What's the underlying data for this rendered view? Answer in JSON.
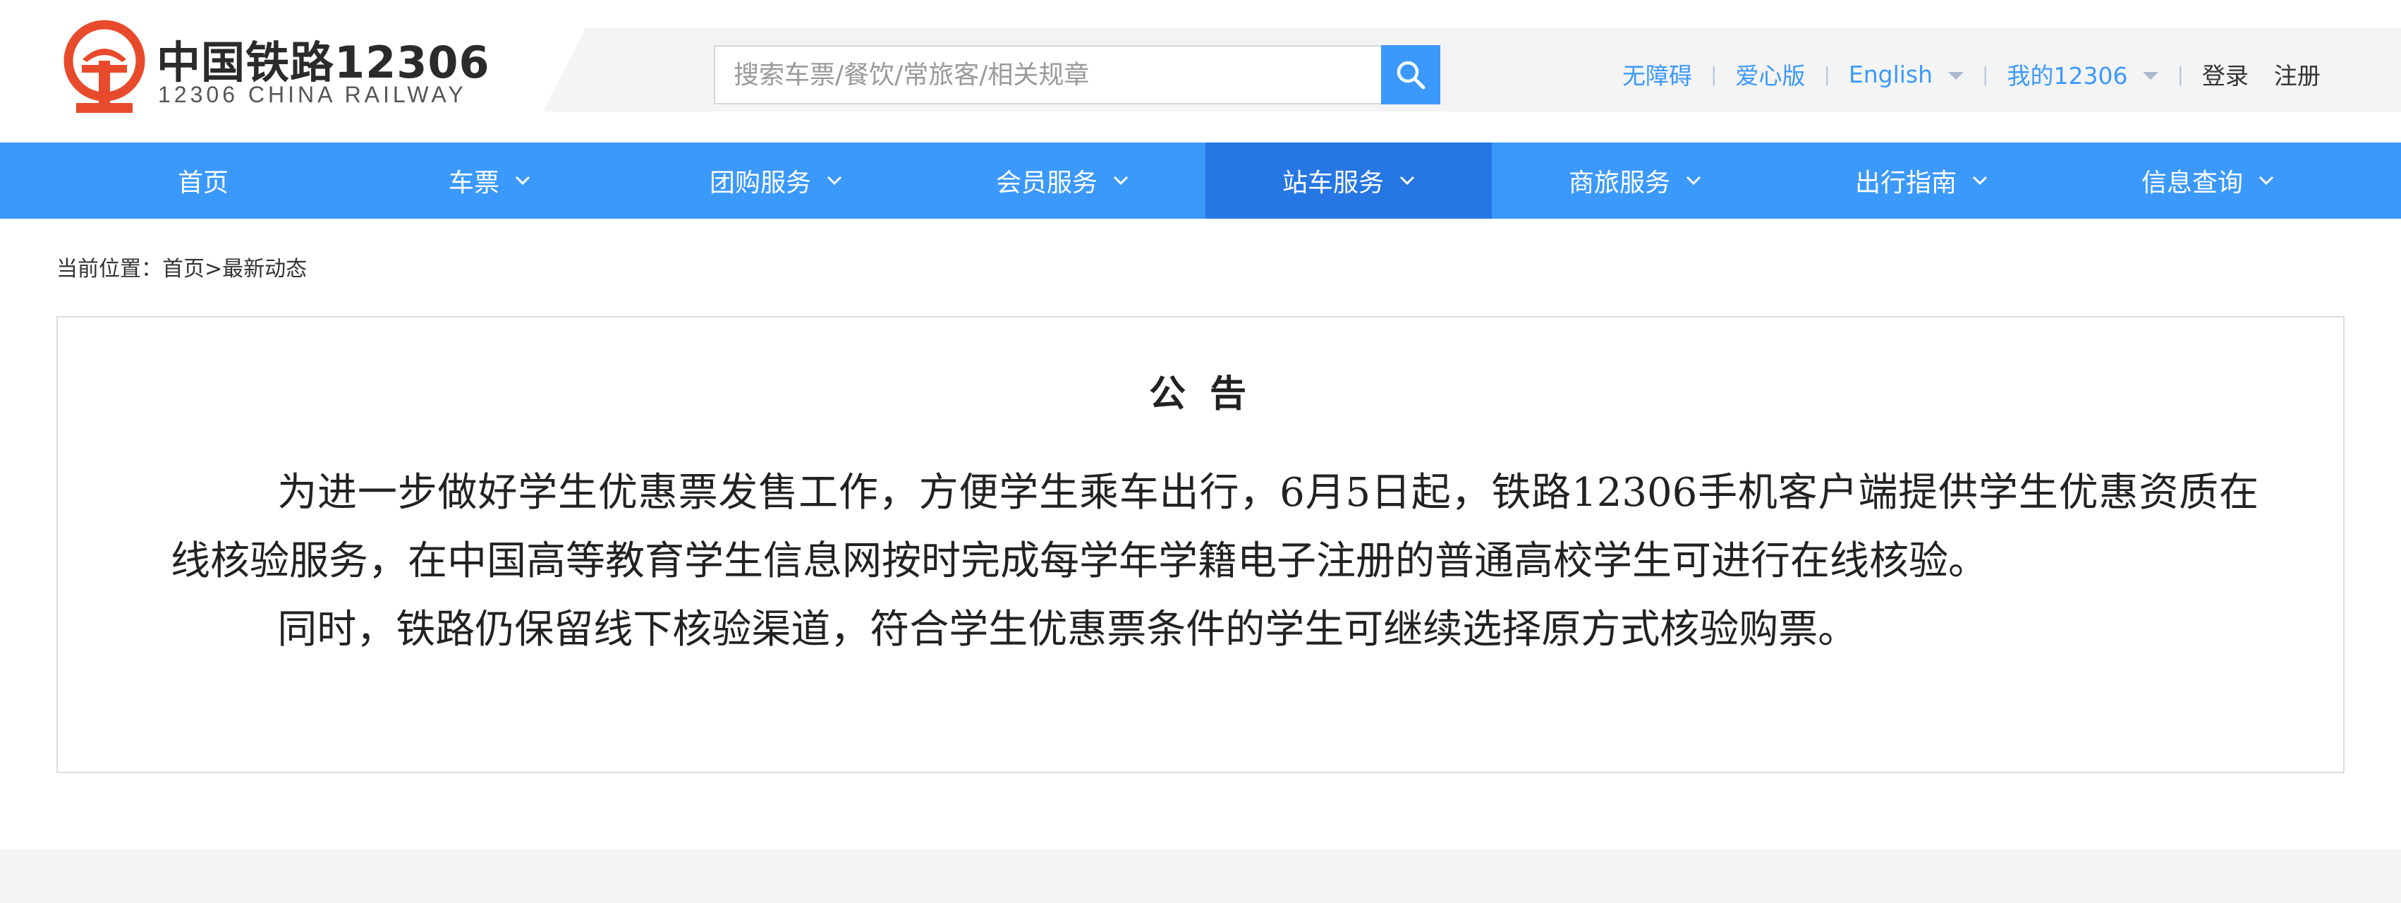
{
  "brand": {
    "name_cn": "中国铁路12306",
    "name_en": "12306 CHINA RAILWAY",
    "logo_icon": "china-railway-logo-icon",
    "color": "#e84b2c"
  },
  "search": {
    "placeholder": "搜索车票/餐饮/常旅客/相关规章",
    "button_icon": "search-icon"
  },
  "top_links": {
    "accessibility": "无障碍",
    "care_mode": "爱心版",
    "language": "English",
    "my_account": "我的12306",
    "login": "登录",
    "register": "注册"
  },
  "nav": {
    "items": [
      {
        "label": "首页"
      },
      {
        "label": "车票"
      },
      {
        "label": "团购服务"
      },
      {
        "label": "会员服务"
      },
      {
        "label": "站车服务"
      },
      {
        "label": "商旅服务"
      },
      {
        "label": "出行指南"
      },
      {
        "label": "信息查询"
      }
    ],
    "active": "站车服务"
  },
  "breadcrumb": {
    "prefix": "当前位置：",
    "home": "首页",
    "separator": ">",
    "current": "最新动态"
  },
  "notice": {
    "title": "公 告",
    "paragraphs": [
      "为进一步做好学生优惠票发售工作，方便学生乘车出行，6月5日起，铁路12306手机客户端提供学生优惠资质在线核验服务，在中国高等教育学生信息网按时完成每学年学籍电子注册的普通高校学生可进行在线核验。",
      "同时，铁路仍保留线下核验渠道，符合学生优惠票条件的学生可继续选择原方式核验购票。"
    ]
  },
  "colors": {
    "primary": "#3b99fc",
    "nav_active": "#2676e3",
    "brand_red": "#e84b2c"
  }
}
